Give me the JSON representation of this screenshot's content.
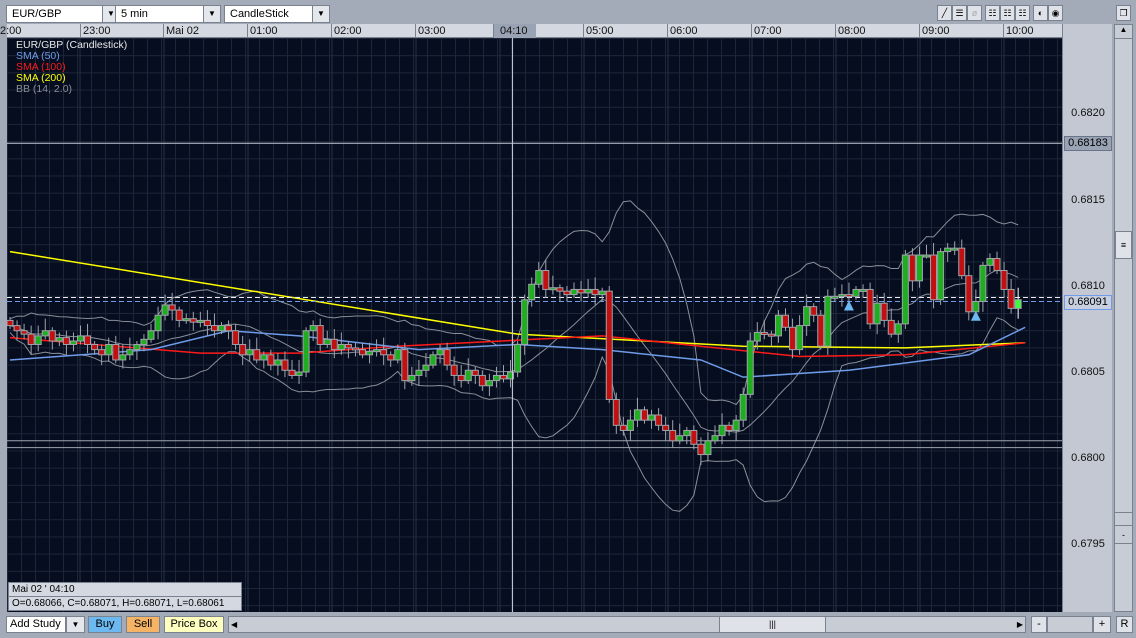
{
  "toolbar": {
    "symbol": "EUR/GBP",
    "interval": "5 min",
    "chart_type": "CandleStick",
    "icons": [
      "draw-line-icon",
      "horizontal-line-icon",
      "delete-icon",
      "grid-1-icon",
      "grid-2-icon",
      "grid-3-icon",
      "theme-light-icon",
      "theme-dark-icon",
      "detach-window-icon"
    ]
  },
  "time_axis": {
    "labels": [
      "2:00",
      "23:00",
      "Mai 02",
      "01:00",
      "02:00",
      "03:00",
      "05:00",
      "06:00",
      "07:00",
      "08:00",
      "09:00",
      "10:00"
    ],
    "crosshair_label": "04:10"
  },
  "price_axis": {
    "labels": [
      "0.6820",
      "0.6815",
      "0.6810",
      "0.6805",
      "0.6800",
      "0.6795"
    ],
    "marker_high": "0.68183",
    "marker_current": "0.68091"
  },
  "legend": {
    "title": "EUR/GBP (Candlestick)",
    "sma50": "SMA (50)",
    "sma100": "SMA (100)",
    "sma200": "SMA (200)",
    "bb": "BB (14, 2.0)"
  },
  "info": {
    "time": "Mai 02 ' 04:10",
    "ohlc": "O=0.68066, C=0.68071, H=0.68071, L=0.68061"
  },
  "bottom": {
    "add_study": "Add Study",
    "buy": "Buy",
    "sell": "Sell",
    "price_box": "Price Box",
    "zoom_out": "-",
    "zoom_in": "+",
    "reset": "R"
  },
  "colors": {
    "up": "#1fae1f",
    "down": "#c01010",
    "sma50": "#6f9be8",
    "sma100": "#ff1a1a",
    "sma200": "#ffff00",
    "bb": "#8a8f98"
  },
  "chart_data": {
    "type": "candlestick",
    "price_base": 0.68,
    "closes_1e5_above_base": [
      77,
      74,
      72,
      66,
      71,
      74,
      68,
      70,
      66,
      68,
      71,
      66,
      63,
      60,
      66,
      57,
      60,
      63,
      66,
      69,
      74,
      83,
      89,
      86,
      80,
      81,
      79,
      80,
      77,
      74,
      77,
      74,
      66,
      60,
      63,
      57,
      60,
      54,
      57,
      51,
      48,
      50,
      74,
      77,
      66,
      69,
      63,
      66,
      64,
      63,
      60,
      62,
      63,
      60,
      57,
      63,
      45,
      48,
      51,
      54,
      60,
      63,
      54,
      48,
      45,
      51,
      48,
      42,
      45,
      48,
      46,
      50,
      66,
      92,
      101,
      109,
      98,
      99,
      97,
      95,
      98,
      96,
      98,
      95,
      97,
      34,
      19,
      16,
      22,
      28,
      22,
      25,
      19,
      16,
      10,
      13,
      16,
      8,
      2,
      10,
      13,
      19,
      16,
      22,
      37,
      68,
      73,
      72,
      71,
      83,
      76,
      63,
      77,
      88,
      83,
      65,
      94,
      94,
      95,
      94,
      98,
      98,
      78,
      90,
      80,
      72,
      78,
      118,
      103,
      118,
      118,
      92,
      120,
      122,
      122,
      106,
      85,
      91,
      112,
      116,
      109,
      98,
      87,
      92
    ],
    "sma200": [
      [
        0,
        120
      ],
      [
        72,
        72
      ],
      [
        104,
        65
      ],
      [
        127,
        64
      ],
      [
        144,
        67
      ]
    ],
    "sma100": [
      [
        0,
        70
      ],
      [
        27,
        61
      ],
      [
        41,
        61
      ],
      [
        55,
        65
      ],
      [
        84,
        71
      ],
      [
        98,
        65
      ],
      [
        112,
        59
      ],
      [
        127,
        60
      ],
      [
        144,
        67
      ]
    ],
    "sma50": [
      [
        0,
        57
      ],
      [
        20,
        63
      ],
      [
        31,
        74
      ],
      [
        41,
        71
      ],
      [
        58,
        63
      ],
      [
        72,
        66
      ],
      [
        84,
        63
      ],
      [
        98,
        57
      ],
      [
        104,
        47
      ],
      [
        119,
        51
      ],
      [
        136,
        60
      ],
      [
        144,
        76
      ]
    ],
    "hlines": {
      "resistance": 0.68183,
      "current": 0.68091,
      "support": [
        0.6801,
        0.68006
      ]
    },
    "signals": [
      {
        "index": 119,
        "price": 0.68091
      },
      {
        "index": 137,
        "price": 0.68085
      }
    ],
    "crosshair_index": 71,
    "ylim": [
      0.679,
      0.6823
    ]
  }
}
